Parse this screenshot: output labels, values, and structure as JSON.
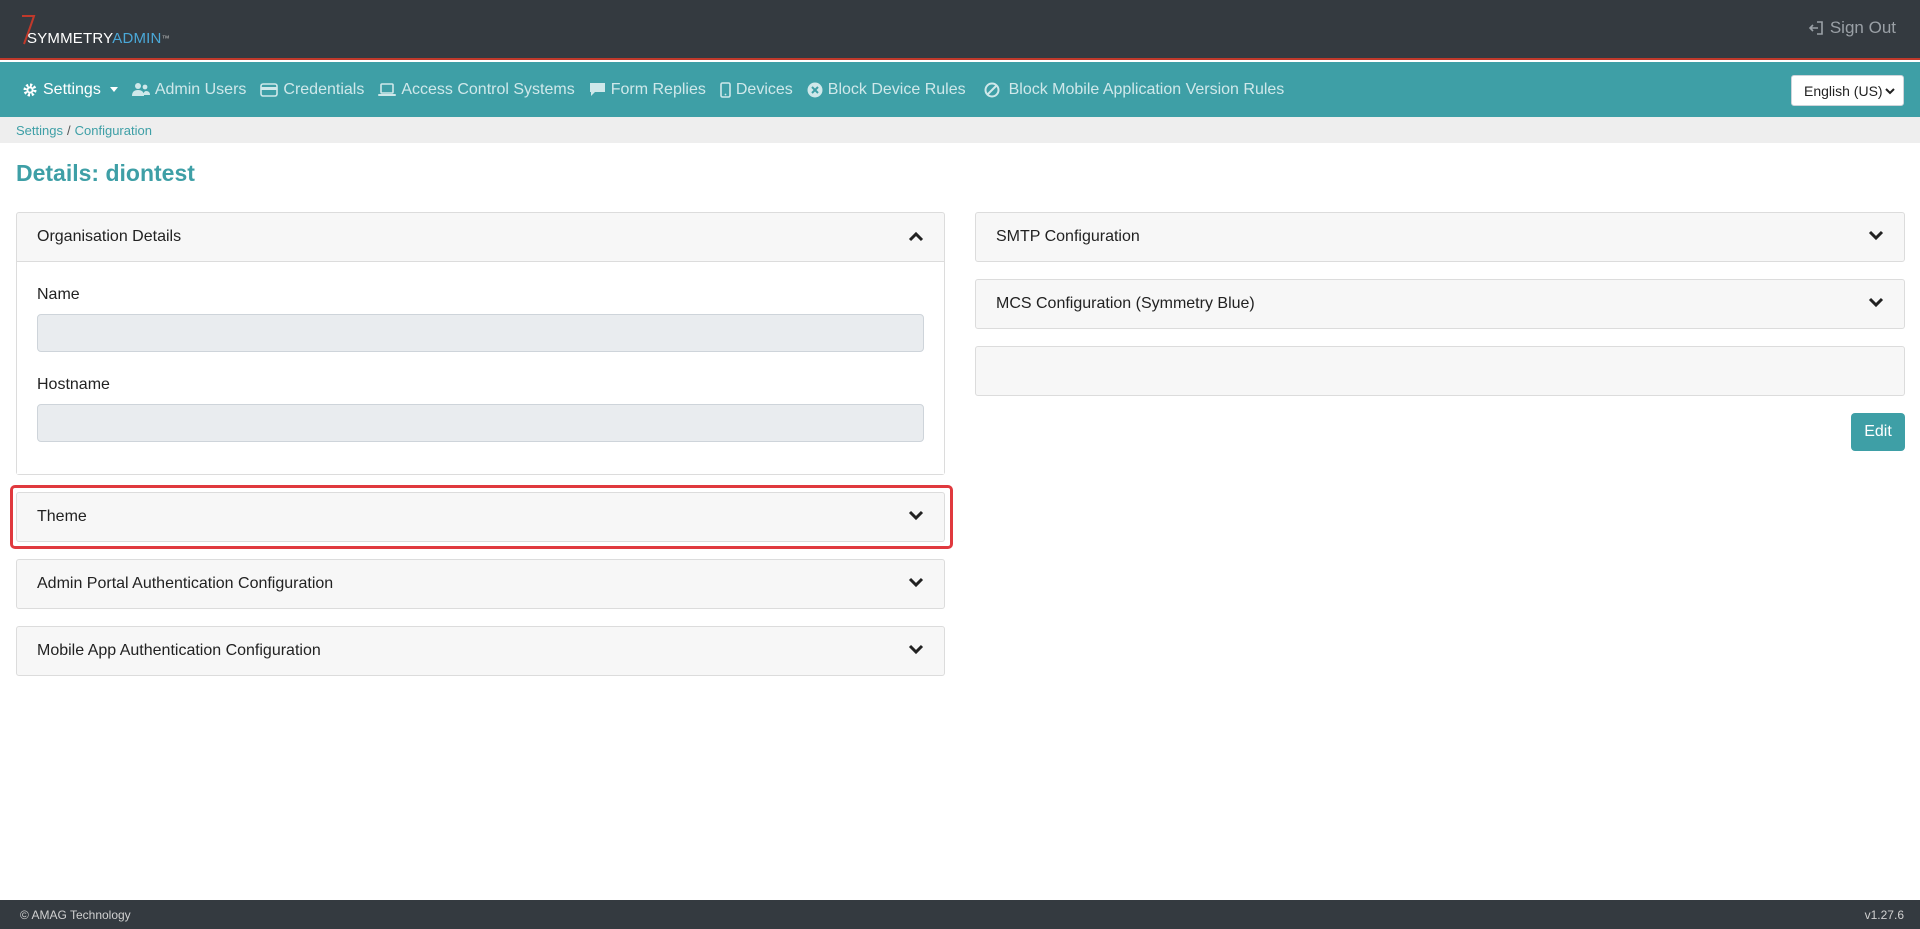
{
  "header": {
    "logo": {
      "brand_a": "SYMMETRY",
      "brand_b": "ADMIN",
      "tm": "™"
    },
    "sign_out_label": "Sign Out"
  },
  "nav": {
    "items": [
      {
        "label": "Settings",
        "icon": "gear-icon",
        "active": true,
        "dropdown": true
      },
      {
        "label": "Admin Users",
        "icon": "users-icon"
      },
      {
        "label": "Credentials",
        "icon": "credit-card-icon"
      },
      {
        "label": "Access Control Systems",
        "icon": "laptop-icon"
      },
      {
        "label": "Form Replies",
        "icon": "comment-icon"
      },
      {
        "label": "Devices",
        "icon": "mobile-icon"
      },
      {
        "label": "Block Device Rules",
        "icon": "times-circle-icon"
      },
      {
        "label": "Block Mobile Application Version Rules",
        "icon": "ban-icon"
      }
    ],
    "language": "English (US)"
  },
  "breadcrumb": {
    "items": [
      "Settings",
      "Configuration"
    ],
    "separator": "/"
  },
  "page_title": "Details: diontest",
  "left_panels": {
    "organisation": {
      "title": "Organisation Details",
      "expanded": true,
      "fields": [
        {
          "label": "Name",
          "value": ""
        },
        {
          "label": "Hostname",
          "value": ""
        }
      ]
    },
    "theme": {
      "title": "Theme"
    },
    "admin_auth": {
      "title": "Admin Portal Authentication Configuration"
    },
    "mobile_auth": {
      "title": "Mobile App Authentication Configuration"
    }
  },
  "right_panels": {
    "smtp": {
      "title": "SMTP Configuration"
    },
    "mcs": {
      "title": "MCS Configuration (Symmetry Blue)"
    },
    "blank": {
      "title": ""
    }
  },
  "edit_label": "Edit",
  "footer": {
    "copyright": "© AMAG Technology",
    "version": "v1.27.6"
  },
  "colors": {
    "accent": "#3e9fa6",
    "dark": "#343a40",
    "highlight": "#e0393e",
    "topbar_rule": "#c0392b"
  }
}
